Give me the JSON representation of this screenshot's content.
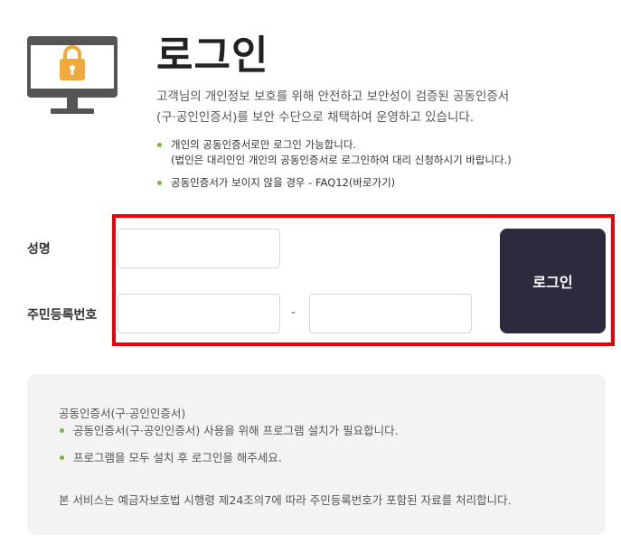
{
  "header": {
    "title": "로그인",
    "description_line1": "고객님의 개인정보 보호를 위해 안전하고 보안성이 검증된 공동인증서",
    "description_line2": "(구·공인인증서)를 보안 수단으로 채택하여 운영하고 있습니다."
  },
  "notes": {
    "item1_line1": "개인의 공동인증서로만 로그인 가능합니다.",
    "item1_line2": "(법인은 대리인인 개인의 공동인증서로 로그인하여 대리 신청하시기 바랍니다.)",
    "item2": "공동인증서가 보이지 않을 경우 - FAQ12(바로가기)"
  },
  "form": {
    "name_label": "성명",
    "rrn_label": "주민등록번호",
    "dash": "-",
    "login_label": "로그인"
  },
  "info": {
    "title": "공동인증서(구·공인인증서)",
    "items": [
      "공동인증서(구·공인인증서) 사용을 위해 프로그램 설치가 필요합니다.",
      "프로그램을 모두 설치 후 로그인을 해주세요."
    ],
    "footer": "본 서비스는 예금자보호법 시행령 제24조의7에 따라 주민등록번호가 포함된 자료를 처리합니다."
  },
  "colors": {
    "accent_bullet": "#7cb342",
    "highlight_box": "#e8000b",
    "login_button": "#2b2b3d",
    "lock": "#f2a93b"
  },
  "icons": {
    "hero": "monitor-lock-icon"
  }
}
